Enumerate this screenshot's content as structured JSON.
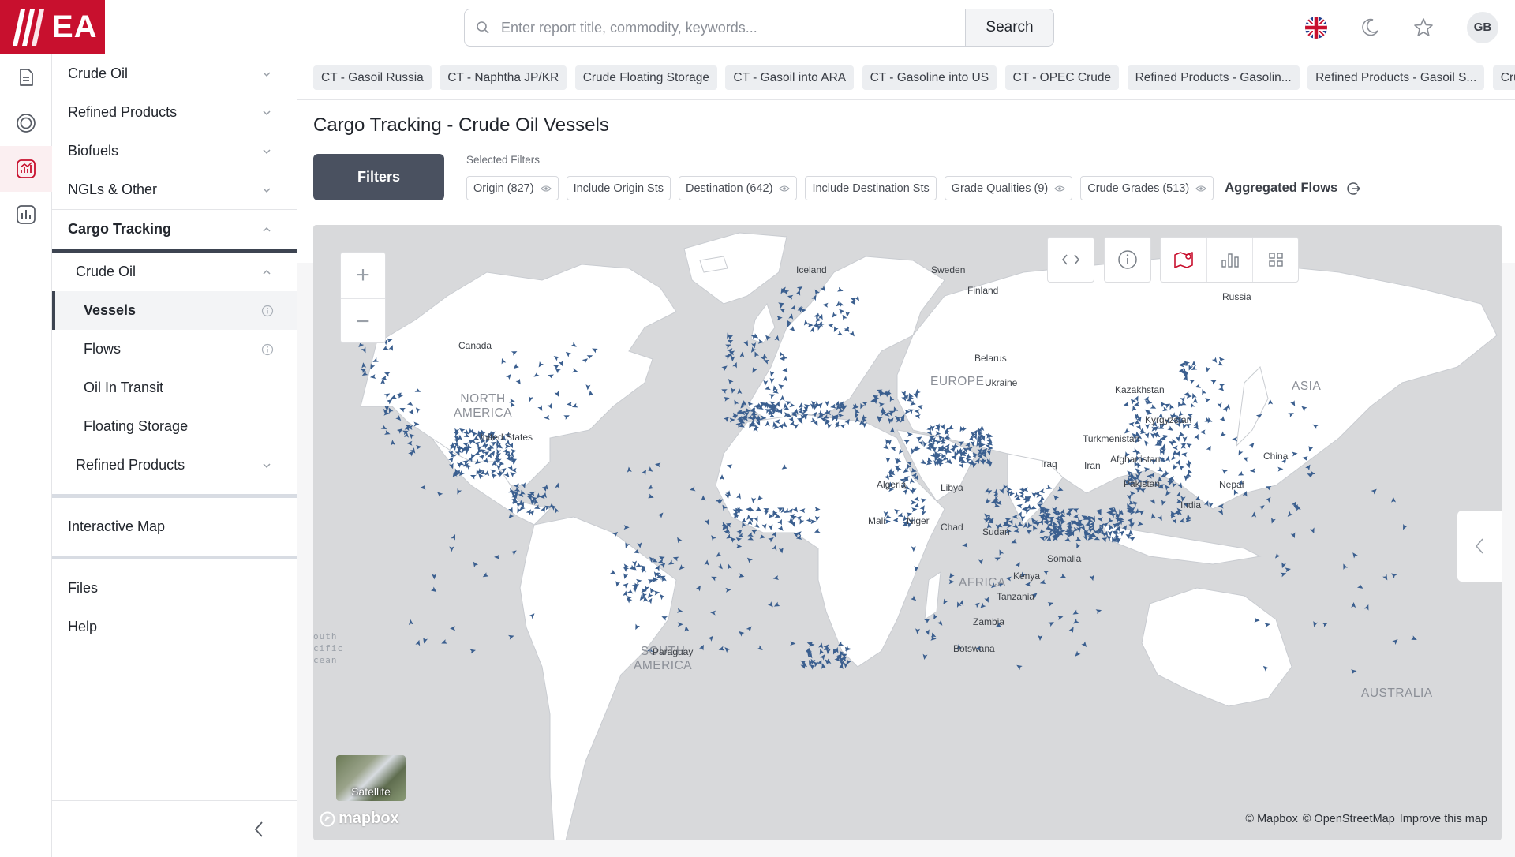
{
  "brand": {
    "logo_text": "EA",
    "accent": "#c8102e"
  },
  "search": {
    "placeholder": "Enter report title, commodity, keywords...",
    "button_label": "Search"
  },
  "header_icons": [
    "uk-flag-icon",
    "moon-icon",
    "star-icon"
  ],
  "user": {
    "initials": "GB"
  },
  "rail": [
    "reports-icon",
    "target-icon",
    "analytics-icon",
    "dashboard-icon"
  ],
  "sidenav": {
    "top_items": [
      "Crude Oil",
      "Refined Products",
      "Biofuels",
      "NGLs & Other"
    ],
    "cargo_tracking": "Cargo Tracking",
    "crude_oil": "Crude Oil",
    "crude_children": [
      "Vessels",
      "Flows",
      "Oil In Transit",
      "Floating Storage"
    ],
    "refined_products": "Refined Products",
    "interactive_map": "Interactive Map",
    "files": "Files",
    "help": "Help"
  },
  "chips": [
    "CT - Gasoil Russia",
    "CT - Naphtha JP/KR",
    "Crude Floating Storage",
    "CT - Gasoil into ARA",
    "CT - Gasoline into US",
    "CT - OPEC Crude",
    "Refined Products - Gasolin...",
    "Refined Products - Gasoil S...",
    "Crude Oil -"
  ],
  "page": {
    "title": "Cargo Tracking - Crude Oil Vessels",
    "filters_button": "Filters",
    "selected_filters_label": "Selected Filters",
    "filters": [
      {
        "label": "Origin (827)",
        "eye": true
      },
      {
        "label": "Include Origin Sts",
        "eye": false
      },
      {
        "label": "Destination (642)",
        "eye": true
      },
      {
        "label": "Include Destination Sts",
        "eye": false
      },
      {
        "label": "Grade Qualities (9)",
        "eye": true
      },
      {
        "label": "Crude Grades (513)",
        "eye": true
      }
    ],
    "aggregated_flows": "Aggregated Flows"
  },
  "map": {
    "zoom_in": "+",
    "zoom_out": "−",
    "satellite_label": "Satellite",
    "mapbox_logo": "mapbox",
    "attribution": [
      "© Mapbox",
      "© OpenStreetMap",
      "Improve this map"
    ],
    "ocean_text": "outh\ncific\ncean",
    "vessel_color": "#3b5f8f",
    "regions": [
      "NORTH\nAMERICA",
      "SOUTH\nAMERICA",
      "EUROPE",
      "AFRICA",
      "ASIA",
      "AUSTRALIA"
    ],
    "labels": [
      "Iceland",
      "Sweden",
      "Finland",
      "Russia",
      "Canada",
      "United States",
      "Belarus",
      "Ukraine",
      "Kazakhstan",
      "Kyrgyzstan",
      "Turkmenistan",
      "China",
      "Iraq",
      "Iran",
      "Afghanistan",
      "Pakistan",
      "Nepal",
      "India",
      "Algeria",
      "Libya",
      "Mali",
      "Niger",
      "Chad",
      "Sudan",
      "Somalia",
      "Kenya",
      "Tanzania",
      "Zambia",
      "Botswana",
      "Paraguay"
    ]
  }
}
